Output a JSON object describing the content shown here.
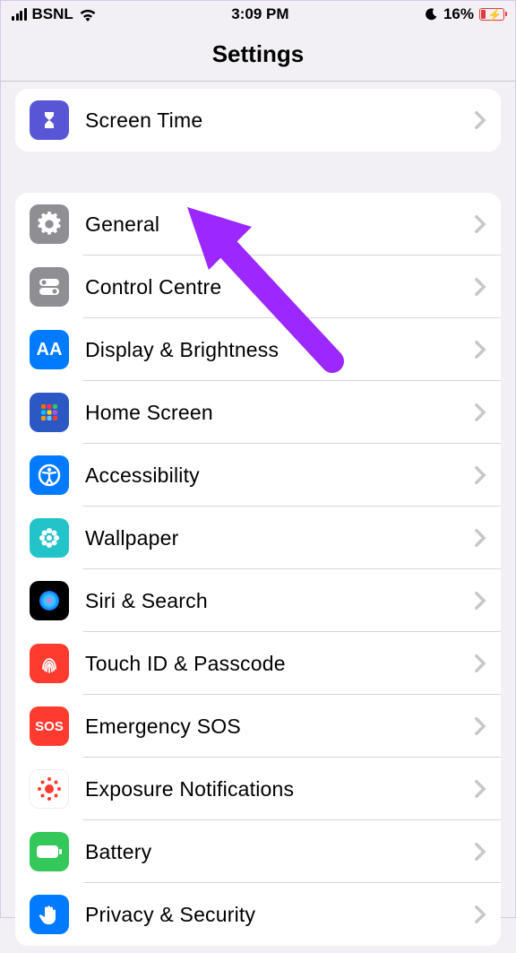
{
  "status": {
    "carrier": "BSNL",
    "time": "3:09 PM",
    "battery_pct": "16%"
  },
  "header": {
    "title": "Settings"
  },
  "section_top": {
    "items": [
      {
        "label": "Screen Time",
        "icon": "hourglass-icon",
        "bg": "bg-purple"
      }
    ]
  },
  "section_main": {
    "items": [
      {
        "label": "General",
        "icon": "gear-icon",
        "bg": "bg-gray"
      },
      {
        "label": "Control Centre",
        "icon": "toggle-icon",
        "bg": "bg-gray"
      },
      {
        "label": "Display & Brightness",
        "icon": "aa-icon",
        "bg": "bg-blue"
      },
      {
        "label": "Home Screen",
        "icon": "grid-icon",
        "bg": "bg-darkblue"
      },
      {
        "label": "Accessibility",
        "icon": "accessibility-icon",
        "bg": "bg-blue"
      },
      {
        "label": "Wallpaper",
        "icon": "flower-icon",
        "bg": "bg-cyan"
      },
      {
        "label": "Siri & Search",
        "icon": "siri-icon",
        "bg": "bg-black"
      },
      {
        "label": "Touch ID & Passcode",
        "icon": "fingerprint-icon",
        "bg": "bg-red"
      },
      {
        "label": "Emergency SOS",
        "icon": "sos-icon",
        "bg": "bg-red"
      },
      {
        "label": "Exposure Notifications",
        "icon": "exposure-icon",
        "bg": "bg-white"
      },
      {
        "label": "Battery",
        "icon": "battery-icon",
        "bg": "bg-green"
      },
      {
        "label": "Privacy & Security",
        "icon": "hand-icon",
        "bg": "bg-blue"
      }
    ]
  },
  "annotation": {
    "target": "General",
    "color": "#9c27ff"
  }
}
